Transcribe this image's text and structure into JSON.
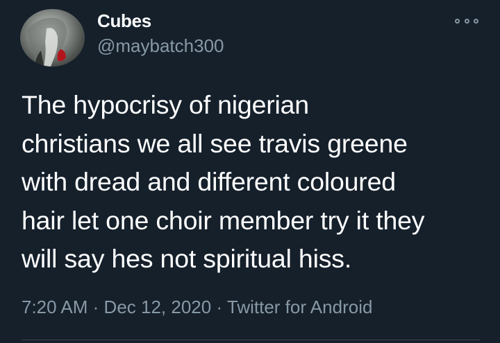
{
  "tweet": {
    "author": {
      "display_name": "Cubes",
      "handle": "@maybatch300",
      "avatar": "avatar-photo"
    },
    "more_icon": "more-options-icon",
    "text": "The hypocrisy of nigerian\nchristians we all see travis greene\nwith dread and different coloured\nhair let one choir member try it they\nwill say hes not spiritual hiss.",
    "time": "7:20 AM",
    "separator": "·",
    "date": "Dec 12, 2020",
    "source": "Twitter for Android"
  },
  "colors": {
    "background": "#15202b",
    "primary_text": "#ffffff",
    "secondary_text": "#8899a6",
    "divider": "#38444d"
  }
}
